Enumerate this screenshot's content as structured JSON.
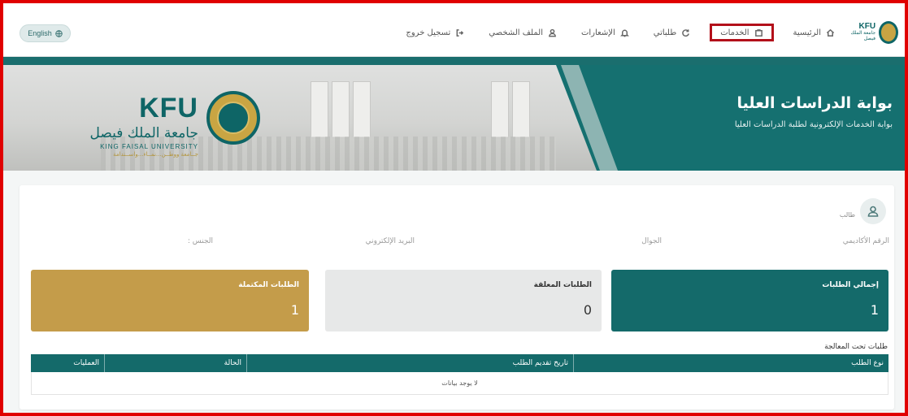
{
  "navbar": {
    "language_button": "English",
    "logo": {
      "short": "KFU",
      "name_ar": "جامعة الملك فيصل",
      "name_en": "KING FAISAL UNIVERSITY"
    },
    "items": [
      {
        "label": "الرئيسية",
        "icon": "home-icon",
        "active": false
      },
      {
        "label": "الخدمات",
        "icon": "briefcase-icon",
        "active": true
      },
      {
        "label": "طلباتي",
        "icon": "refresh-icon",
        "active": false
      },
      {
        "label": "الإشعارات",
        "icon": "bell-icon",
        "active": false
      },
      {
        "label": "الملف الشخصي",
        "icon": "user-icon",
        "active": false
      },
      {
        "label": "تسجيل خروج",
        "icon": "logout-icon",
        "active": false
      }
    ]
  },
  "banner": {
    "title": "بوابة الدراسات العليا",
    "subtitle": "بوابة الخدمات الإلكترونية لطلبة الدراسات العليا",
    "kfu_short": "KFU",
    "kfu_name_ar": "جامعة الملك فيصل",
    "kfu_name_en": "KING FAISAL UNIVERSITY",
    "kfu_slogan": "جــامعة ووطــن...نمــاء...واســتدامة"
  },
  "profile": {
    "role": "طالب",
    "fields": {
      "academic_id": "الرقم الأكاديمي",
      "mobile": "الجوال",
      "email": "البريد الإلكتروني",
      "gender": "الجنس :"
    }
  },
  "stats": {
    "total": {
      "label": "إجمالي الطلبات",
      "value": "1"
    },
    "pending": {
      "label": "الطلبات المعلقة",
      "value": "0"
    },
    "completed": {
      "label": "الطلبات المكتملة",
      "value": "1"
    }
  },
  "requests_section": {
    "title": "طلبات تحت المعالجة",
    "columns": {
      "type": "نوع الطلب",
      "date": "تاريخ تقديم الطلب",
      "status": "الحالة",
      "actions": "العمليات"
    },
    "empty_text": "لا يوجد بيانات"
  },
  "colors": {
    "primary": "#146a6a",
    "gold": "#c49c4a",
    "highlight": "#b3101a",
    "frame": "#e00000"
  }
}
